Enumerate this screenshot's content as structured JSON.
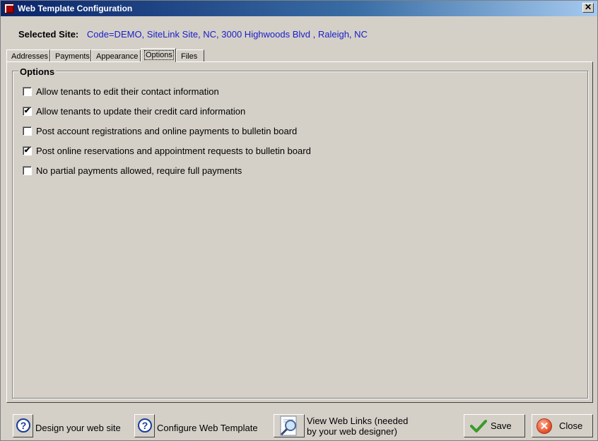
{
  "window": {
    "title": "Web Template Configuration",
    "close_glyph": "✕"
  },
  "selected_site": {
    "label": "Selected Site:",
    "value": "Code=DEMO,   SiteLink Site, NC, 3000 Highwoods Blvd , Raleigh, NC"
  },
  "tabs": [
    {
      "label": "Addresses"
    },
    {
      "label": "Payments"
    },
    {
      "label": "Appearance"
    },
    {
      "label": "Options",
      "active": true
    },
    {
      "label": "Files"
    }
  ],
  "options_group": {
    "title": "Options",
    "items": [
      {
        "label": "Allow tenants to edit their contact information",
        "checked": false,
        "mark": ""
      },
      {
        "label": "Allow tenants to update their credit card information",
        "checked": true,
        "mark": "✔"
      },
      {
        "label": "Post account registrations and online payments to bulletin board",
        "checked": false,
        "mark": ""
      },
      {
        "label": "Post online reservations and appointment requests to bulletin board",
        "checked": true,
        "mark": "✔"
      },
      {
        "label": "No partial payments allowed, require full payments",
        "checked": false,
        "mark": ""
      }
    ]
  },
  "footer": {
    "design_label": "Design your web site",
    "configure_label": "Configure Web Template",
    "view_links_line1": "View Web Links (needed",
    "view_links_line2": "by your web designer)",
    "save_label": "Save",
    "close_label": "Close",
    "help_glyph": "?",
    "close_icon_glyph": "✕"
  },
  "colors": {
    "dialog_bg": "#d4d0c8",
    "site_value": "#1a20c8",
    "titlebar": "#0a246a"
  },
  "icons": [
    "app-icon",
    "help-icon",
    "magnifier-icon",
    "checkmark-icon",
    "close-x-icon"
  ]
}
